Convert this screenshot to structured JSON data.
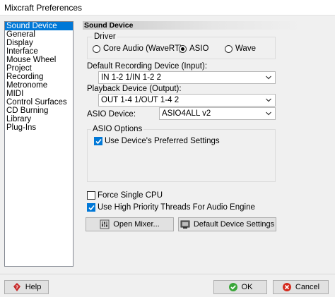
{
  "window": {
    "title": "Mixcraft Preferences"
  },
  "sidebar": {
    "items": [
      {
        "label": "Sound Device",
        "selected": true
      },
      {
        "label": "General"
      },
      {
        "label": "Display"
      },
      {
        "label": "Interface"
      },
      {
        "label": "Mouse Wheel"
      },
      {
        "label": "Project"
      },
      {
        "label": "Recording"
      },
      {
        "label": "Metronome"
      },
      {
        "label": "MIDI"
      },
      {
        "label": "Control Surfaces"
      },
      {
        "label": "CD Burning"
      },
      {
        "label": "Library"
      },
      {
        "label": "Plug-Ins"
      }
    ]
  },
  "panel": {
    "header": "Sound Device",
    "driver": {
      "label": "Driver",
      "options": [
        "Core Audio (WaveRT)",
        "ASIO",
        "Wave"
      ],
      "selected": "ASIO"
    },
    "recording": {
      "label": "Default Recording Device (Input):",
      "value": "IN 1-2 1/IN 1-2 2"
    },
    "playback": {
      "label": "Playback Device (Output):",
      "value": "OUT 1-4 1/OUT 1-4 2"
    },
    "asio_device": {
      "label": "ASIO Device:",
      "value": "ASIO4ALL v2"
    },
    "asio_options": {
      "label": "ASIO Options",
      "preferred_settings": {
        "label": "Use Device's Preferred Settings",
        "checked": true
      }
    },
    "force_single_cpu": {
      "label": "Force Single CPU",
      "checked": false
    },
    "high_priority": {
      "label": "Use High Priority Threads For Audio Engine",
      "checked": true
    },
    "open_mixer_label": "Open Mixer...",
    "default_settings_label": "Default Device Settings"
  },
  "footer": {
    "help_label": "Help",
    "ok_label": "OK",
    "cancel_label": "Cancel"
  },
  "colors": {
    "selection": "#0078d7",
    "ok_green": "#3aa639",
    "cancel_red": "#d52b1e",
    "help_red": "#c62828"
  }
}
